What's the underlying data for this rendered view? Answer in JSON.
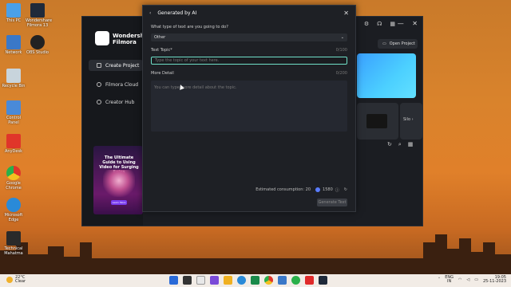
{
  "desktop": {
    "icons": [
      {
        "label": "This PC",
        "color": "#4aa0e8"
      },
      {
        "label": "Wondershare Filmora 13",
        "color": "#1f2a3a"
      },
      {
        "label": "Network",
        "color": "#3a78c8"
      },
      {
        "label": "OBS Studio",
        "color": "#222222"
      },
      {
        "label": "Recycle Bin",
        "color": "#c8d4dc"
      },
      {
        "label": "Control Panel",
        "color": "#4a8ad8"
      },
      {
        "label": "AnyDesk",
        "color": "#e0352a"
      },
      {
        "label": "Google Chrome",
        "color": "#f4c020"
      },
      {
        "label": "Microsoft Edge",
        "color": "#2a8ad8"
      },
      {
        "label": "Technical Mahatma",
        "color": "#2a2a2a"
      }
    ]
  },
  "filmora": {
    "logo_text": "Wondershare Filmora",
    "nav": [
      {
        "label": "Create Project"
      },
      {
        "label": "Filmora Cloud"
      },
      {
        "label": "Creator Hub"
      }
    ],
    "ad": {
      "title": "The Ultimate Guide to Using Video for Surging Sales",
      "button": "Learn More"
    },
    "open_project": "Open Project",
    "card2_label": "Silo"
  },
  "dialog": {
    "title": "Generated by AI",
    "question": "What type of text are you going to do?",
    "type_value": "Other",
    "topic_label": "Text Topic*",
    "topic_count": "0/100",
    "topic_placeholder": "Type the topic of your text here.",
    "detail_label": "More Detail",
    "detail_count": "0/200",
    "detail_placeholder": "You can type more detail about the topic.",
    "consumption": "Estimated consumption: 20",
    "credits": "1580",
    "generate": "Generate Text"
  },
  "taskbar": {
    "temp": "22°C",
    "condition": "Clear",
    "lang1": "ENG",
    "lang2": "IN",
    "time": "19:05",
    "date": "25-11-2023",
    "apps": [
      "#2a6ad8",
      "#333333",
      "#e8e8e8",
      "#7a4ad8",
      "#f0b020",
      "#2a8ad8",
      "#1a8a4a",
      "#f0c040",
      "#3a78c8",
      "#2ab04a",
      "#e02a2a",
      "#1f2a3a"
    ]
  }
}
